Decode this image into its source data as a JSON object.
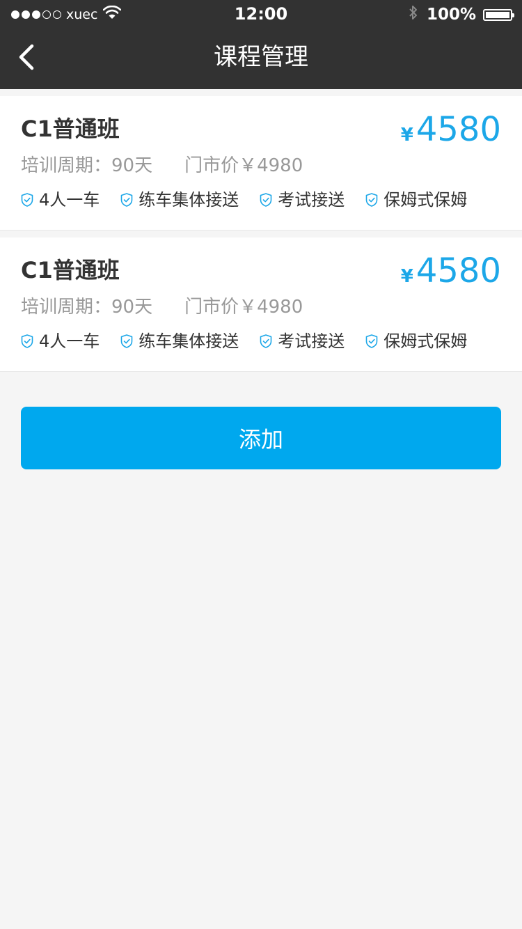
{
  "status_bar": {
    "carrier": "xuec",
    "time": "12:00",
    "battery": "100%",
    "signal_filled": 3,
    "signal_total": 5
  },
  "nav": {
    "title": "课程管理",
    "back_icon": "chevron-left-icon"
  },
  "courses": [
    {
      "name": "C1普通班",
      "price_symbol": "¥",
      "price": "4580",
      "period": "培训周期：90天",
      "market_price": "门市价￥4980",
      "features": [
        "4人一车",
        "练车集体接送",
        "考试接送",
        "保姆式保姆"
      ]
    },
    {
      "name": "C1普通班",
      "price_symbol": "¥",
      "price": "4580",
      "period": "培训周期：90天",
      "market_price": "门市价￥4980",
      "features": [
        "4人一车",
        "练车集体接送",
        "考试接送",
        "保姆式保姆"
      ]
    }
  ],
  "add_button": {
    "label": "添加"
  },
  "colors": {
    "header": "#323232",
    "accent": "#1ca7e8",
    "button": "#00a8ee",
    "background": "#f5f5f5"
  }
}
